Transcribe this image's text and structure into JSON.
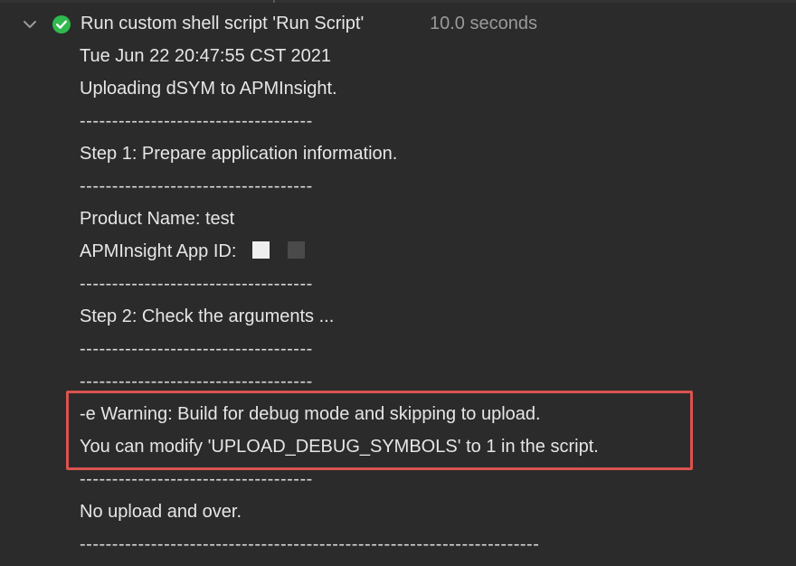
{
  "header": {
    "title": "Run custom shell script 'Run Script'",
    "duration": "10.0 seconds",
    "status_icon": "checkmark-circle-icon",
    "status_color": "#2fb94f",
    "expand_icon": "chevron-down-icon"
  },
  "log": {
    "lines": [
      "Tue Jun 22 20:47:55 CST 2021",
      "Uploading dSYM to APMInsight.",
      "------------------------------------",
      "Step 1: Prepare application information.",
      "------------------------------------",
      "Product Name: test",
      "APMInsight App ID:",
      "------------------------------------",
      "Step 2: Check the arguments ...",
      "------------------------------------",
      "------------------------------------",
      "-e Warning: Build for debug mode and skipping to upload.",
      "You can modify 'UPLOAD_DEBUG_SYMBOLS' to 1 in the script.",
      "------------------------------------",
      "No upload and over.",
      "-----------------------------------------------------------------------"
    ]
  },
  "highlight": {
    "color": "#d9534f"
  }
}
